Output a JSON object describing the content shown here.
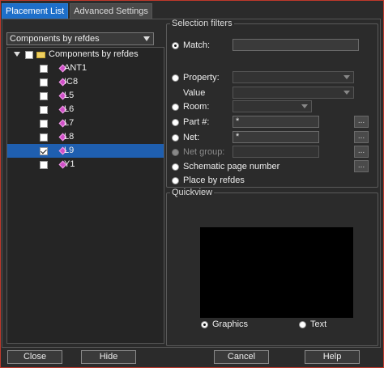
{
  "tabs": [
    {
      "label": "Placement List",
      "active": true
    },
    {
      "label": "Advanced Settings",
      "active": false
    }
  ],
  "mode_dropdown": {
    "selected": "Components by refdes"
  },
  "tree": {
    "root": {
      "label": "Components by refdes",
      "checked": false,
      "expanded": true
    },
    "items": [
      {
        "label": "ANT1",
        "checked": false,
        "selected": false
      },
      {
        "label": "IC8",
        "checked": false,
        "selected": false
      },
      {
        "label": "L5",
        "checked": false,
        "selected": false
      },
      {
        "label": "L6",
        "checked": false,
        "selected": false
      },
      {
        "label": "L7",
        "checked": false,
        "selected": false
      },
      {
        "label": "L8",
        "checked": false,
        "selected": false
      },
      {
        "label": "L9",
        "checked": true,
        "selected": true
      },
      {
        "label": "Y1",
        "checked": false,
        "selected": false
      }
    ]
  },
  "selection_filters": {
    "title": "Selection filters",
    "match": {
      "label": "Match:",
      "value": "",
      "selected": true
    },
    "property": {
      "label": "Property:",
      "value": ""
    },
    "value": {
      "label": "Value",
      "value": ""
    },
    "room": {
      "label": "Room:",
      "value": ""
    },
    "part": {
      "label": "Part #:",
      "value": "*",
      "browse": "..."
    },
    "net": {
      "label": "Net:",
      "value": "*",
      "browse": "..."
    },
    "net_group": {
      "label": "Net group:",
      "value": "",
      "browse": "...",
      "disabled": true
    },
    "schematic_page": {
      "label": "Schematic page number",
      "browse": "..."
    },
    "place_by_refdes": {
      "label": "Place by refdes"
    }
  },
  "quickview": {
    "title": "Quickview",
    "graphics": {
      "label": "Graphics",
      "selected": true
    },
    "text": {
      "label": "Text",
      "selected": false
    }
  },
  "buttons": {
    "close": "Close",
    "hide": "Hide",
    "cancel": "Cancel",
    "help": "Help"
  },
  "colors": {
    "background": "#2b2b2b",
    "active_tab": "#1e6fc9",
    "selection": "#1f5fb0",
    "frame_border": "#c0392b",
    "component_icon": "#d04ec8",
    "folder_icon": "#f0d060"
  }
}
